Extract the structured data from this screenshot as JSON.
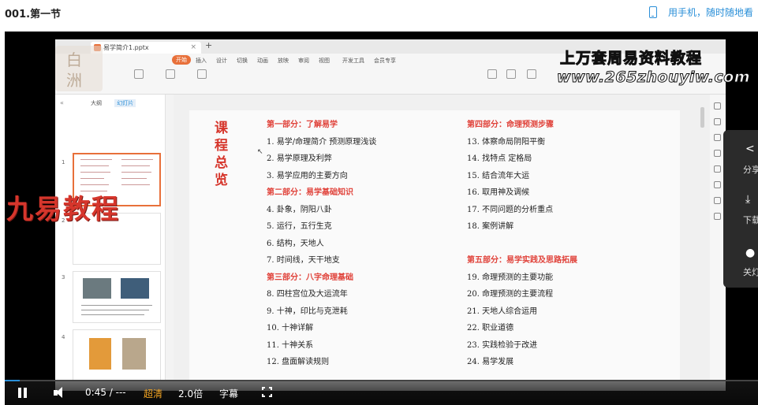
{
  "page": {
    "title": "001.第一节",
    "mobile_link": "用手机，随时随地看"
  },
  "recording": {
    "file_tab": "易学简介1.pptx",
    "ribbon_tabs": [
      "开始",
      "插入",
      "设计",
      "切换",
      "动画",
      "放映",
      "审阅",
      "视图",
      "开发工具",
      "会员专享"
    ],
    "panel_tabs": [
      "大纲",
      "幻灯片"
    ],
    "thumb_numbers": [
      "1",
      "2",
      "3",
      "4",
      "5"
    ],
    "watermark_logo": [
      "白",
      "洲"
    ],
    "watermark_title": "上万套周易资料教程",
    "watermark_url": "www.265zhouyiw.com",
    "brand_overlay": "九易教程"
  },
  "slide": {
    "title_vertical": [
      "课",
      "程",
      "总",
      "览"
    ],
    "left_column": [
      {
        "type": "head",
        "text": "第一部分：了解易学"
      },
      {
        "type": "item",
        "text": "1. 易学/命理简介  预测原理浅谈"
      },
      {
        "type": "item",
        "text": "2. 易学原理及利弊"
      },
      {
        "type": "item",
        "text": "3. 易学应用的主要方向"
      },
      {
        "type": "head",
        "text": "第二部分：易学基础知识"
      },
      {
        "type": "item",
        "text": "4. 卦象，阴阳八卦"
      },
      {
        "type": "item",
        "text": "5. 运行，五行生克"
      },
      {
        "type": "item",
        "text": "6. 结构，天地人"
      },
      {
        "type": "item",
        "text": "7. 时间线，天干地支"
      },
      {
        "type": "head",
        "text": "第三部分：八字命理基础"
      },
      {
        "type": "item",
        "text": "8. 四柱宫位及大运流年"
      },
      {
        "type": "item",
        "text": "9. 十神，印比与克泄耗"
      },
      {
        "type": "item",
        "text": "10. 十神详解"
      },
      {
        "type": "item",
        "text": "11. 十神关系"
      },
      {
        "type": "item",
        "text": "12. 盘面解读规则"
      }
    ],
    "right_column": [
      {
        "type": "head",
        "text": "第四部分：命理预测步骤"
      },
      {
        "type": "item",
        "text": "13. 体察命局阴阳平衡"
      },
      {
        "type": "item",
        "text": "14. 找特点  定格局"
      },
      {
        "type": "item",
        "text": "15. 结合流年大运"
      },
      {
        "type": "item",
        "text": "16. 取用神及调候"
      },
      {
        "type": "item",
        "text": "17. 不同问题的分析重点"
      },
      {
        "type": "item",
        "text": "18. 案例讲解"
      },
      {
        "type": "blank",
        "text": ""
      },
      {
        "type": "head",
        "text": "第五部分：易学实践及思路拓展"
      },
      {
        "type": "item",
        "text": "19. 命理预测的主要功能"
      },
      {
        "type": "item",
        "text": "20. 命理预测的主要流程"
      },
      {
        "type": "item",
        "text": "21. 天地人综合运用"
      },
      {
        "type": "item",
        "text": "22. 职业道德"
      },
      {
        "type": "item",
        "text": "23. 实践检验于改进"
      },
      {
        "type": "item",
        "text": "24. 易学发展"
      }
    ]
  },
  "side_panel": {
    "share": "分享",
    "download": "下载",
    "light_off": "关灯"
  },
  "player": {
    "time": "0:45 / ---",
    "quality": "超清",
    "speed": "2.0倍",
    "subtitle": "字幕",
    "progress": 0.02
  },
  "colors": {
    "accent_blue": "#2a8fd8",
    "slide_red": "#d6362c",
    "quality_orange": "#f5a623",
    "wps_orange": "#e8703a"
  }
}
